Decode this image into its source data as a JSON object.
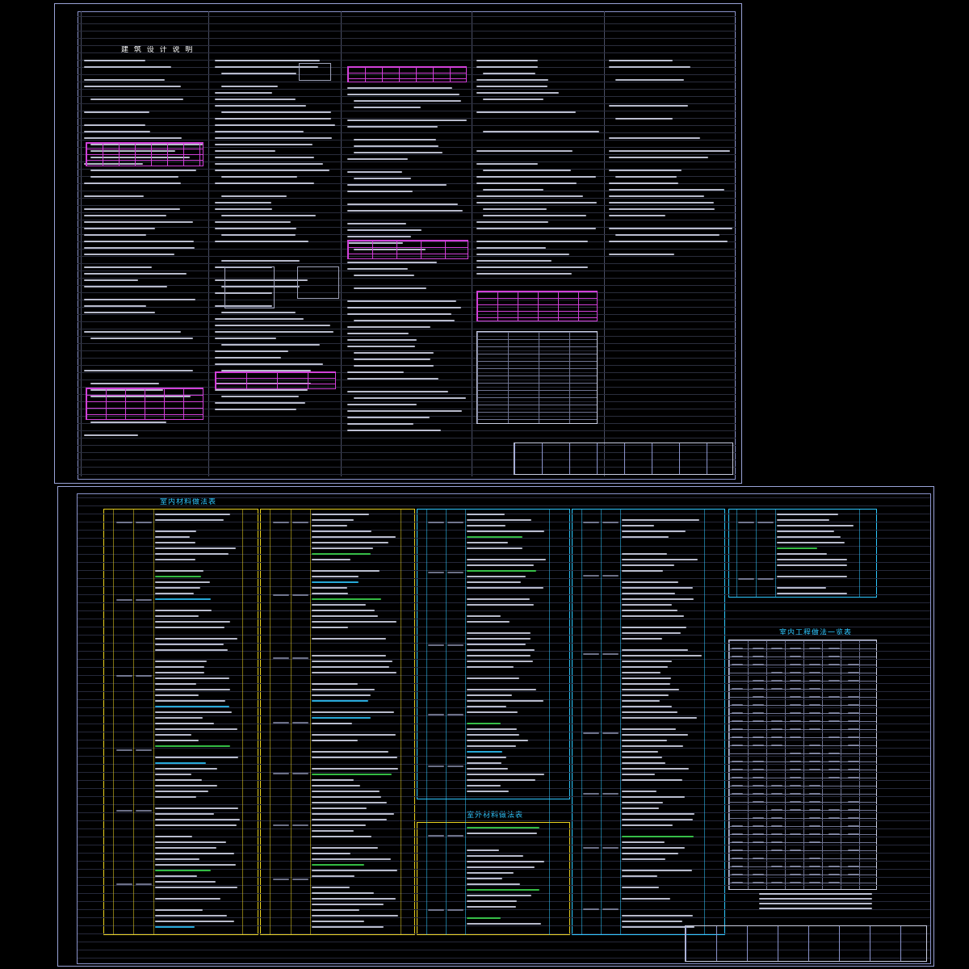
{
  "top_sheet": {
    "title": "建 筑 设 计 说 明"
  },
  "bottom_sheet": {
    "section_1_title": "室内材料做法表",
    "section_2_title": "室外材料做法表",
    "section_3_title": "室内工程做法一览表"
  },
  "colors": {
    "background": "#000000",
    "frame": "#9aa3d8",
    "text": "#d8dcf0",
    "table_magenta": "#d040d8",
    "heading_cyan": "#2ec7ff",
    "highlight_green": "#3ddc50",
    "grid_yellow": "#e8d020"
  }
}
